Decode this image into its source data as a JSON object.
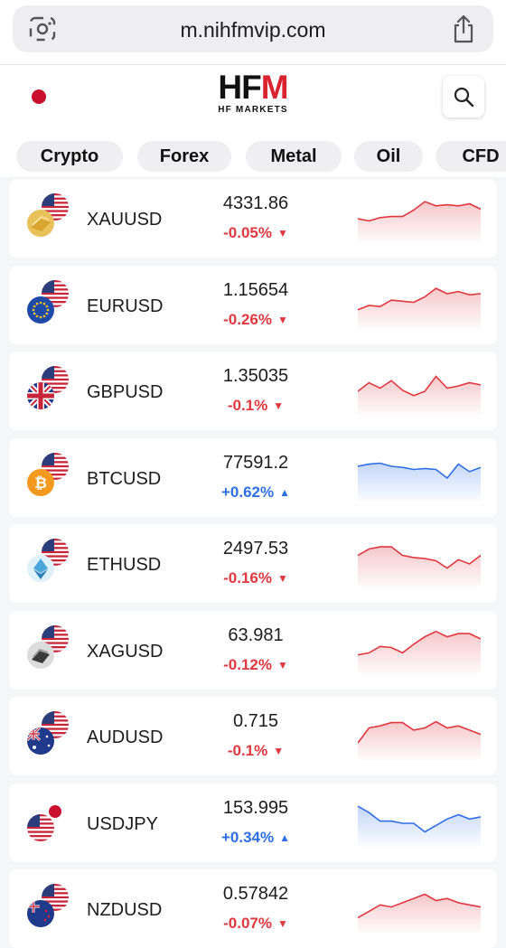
{
  "browser": {
    "url": "m.nihfmvip.com"
  },
  "header": {
    "logo_main": "HFM",
    "logo_sub": "HF MARKETS"
  },
  "tabs": [
    {
      "label": "Crypto"
    },
    {
      "label": "Forex"
    },
    {
      "label": "Metal"
    },
    {
      "label": "Oil"
    },
    {
      "label": "CFD"
    }
  ],
  "colors": {
    "down": "#e0383f",
    "up": "#2e6fe6",
    "brand_red": "#d9232e"
  },
  "instruments": [
    {
      "symbol": "XAUUSD",
      "price": "4331.86",
      "change": "-0.05%",
      "direction": "down",
      "secondary_icon": "gold-icon",
      "trend": [
        22,
        20,
        23,
        24,
        24,
        30,
        38,
        34,
        35,
        34,
        36,
        31
      ]
    },
    {
      "symbol": "EURUSD",
      "price": "1.15654",
      "change": "-0.26%",
      "direction": "down",
      "secondary_icon": "eu-flag-icon",
      "trend": [
        18,
        22,
        21,
        27,
        26,
        25,
        30,
        38,
        33,
        35,
        32,
        33
      ]
    },
    {
      "symbol": "GBPUSD",
      "price": "1.35035",
      "change": "-0.1%",
      "direction": "down",
      "secondary_icon": "uk-flag-icon",
      "trend": [
        22,
        30,
        25,
        32,
        23,
        18,
        22,
        36,
        25,
        27,
        30,
        28
      ]
    },
    {
      "symbol": "BTCUSD",
      "price": "77591.2",
      "change": "+0.62%",
      "direction": "up",
      "secondary_icon": "bitcoin-icon",
      "trend": [
        33,
        35,
        36,
        33,
        32,
        30,
        31,
        30,
        22,
        35,
        28,
        32
      ]
    },
    {
      "symbol": "ETHUSD",
      "price": "2497.53",
      "change": "-0.16%",
      "direction": "down",
      "secondary_icon": "ethereum-icon",
      "trend": [
        30,
        36,
        38,
        38,
        30,
        28,
        27,
        25,
        18,
        26,
        22,
        30
      ]
    },
    {
      "symbol": "XAGUSD",
      "price": "63.981",
      "change": "-0.12%",
      "direction": "down",
      "secondary_icon": "silver-icon",
      "trend": [
        18,
        20,
        26,
        25,
        20,
        28,
        35,
        40,
        35,
        38,
        38,
        33
      ]
    },
    {
      "symbol": "AUDUSD",
      "price": "0.715",
      "change": "-0.1%",
      "direction": "down",
      "secondary_icon": "australia-flag-icon",
      "trend": [
        16,
        30,
        32,
        35,
        35,
        28,
        30,
        36,
        30,
        32,
        28,
        24
      ]
    },
    {
      "symbol": "USDJPY",
      "price": "153.995",
      "change": "+0.34%",
      "direction": "up",
      "secondary_icon": "us-flag-icon",
      "trend": [
        38,
        32,
        24,
        24,
        22,
        22,
        14,
        20,
        26,
        30,
        26,
        28
      ]
    },
    {
      "symbol": "NZDUSD",
      "price": "0.57842",
      "change": "-0.07%",
      "direction": "down",
      "secondary_icon": "new-zealand-flag-icon",
      "trend": [
        14,
        20,
        26,
        24,
        28,
        32,
        36,
        30,
        32,
        28,
        26,
        24
      ]
    }
  ]
}
